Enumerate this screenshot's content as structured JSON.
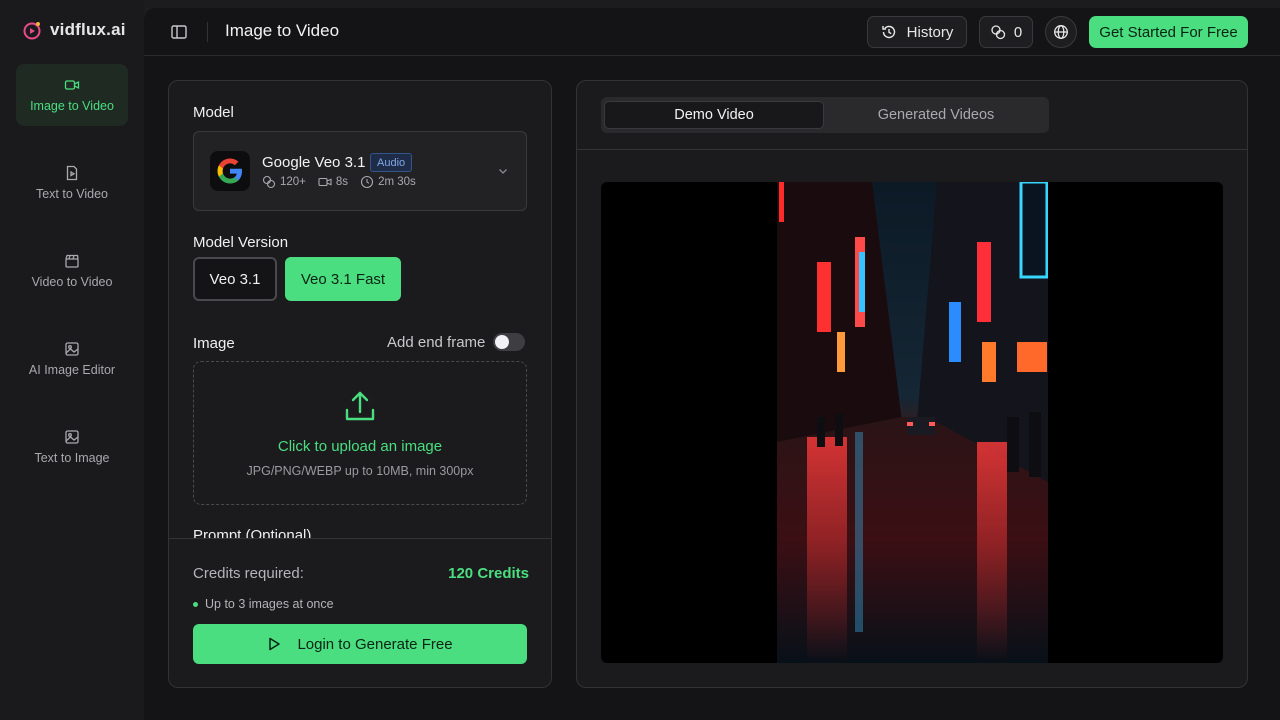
{
  "brand": {
    "name": "vidflux.ai"
  },
  "sidebar": {
    "items": [
      {
        "label": "Image to Video",
        "icon": "video-camera-icon",
        "active": true
      },
      {
        "label": "Text to Video",
        "icon": "document-icon",
        "active": false
      },
      {
        "label": "Video to Video",
        "icon": "clapperboard-icon",
        "active": false
      },
      {
        "label": "AI Image Editor",
        "icon": "image-icon",
        "active": false
      },
      {
        "label": "Text to Image",
        "icon": "image-icon",
        "active": false
      }
    ]
  },
  "header": {
    "title": "Image to Video",
    "history_label": "History",
    "credits_count": "0",
    "cta_label": "Get Started For Free"
  },
  "form": {
    "model_label": "Model",
    "model": {
      "name": "Google Veo 3.1",
      "badge": "Audio",
      "credits": "120+",
      "duration": "8s",
      "time": "2m 30s"
    },
    "version_label": "Model Version",
    "versions": [
      {
        "label": "Veo 3.1",
        "selected": false
      },
      {
        "label": "Veo 3.1 Fast",
        "selected": true
      }
    ],
    "image_label": "Image",
    "end_frame_label": "Add end frame",
    "upload_title": "Click to upload an image",
    "upload_hint": "JPG/PNG/WEBP up to 10MB, min 300px",
    "prompt_label": "Prompt (Optional)"
  },
  "footer": {
    "credits_label": "Credits required:",
    "credits_value": "120 Credits",
    "note": "Up to 3 images at once",
    "generate_label": "Login to Generate Free"
  },
  "preview": {
    "tabs": [
      {
        "label": "Demo Video",
        "active": true
      },
      {
        "label": "Generated Videos",
        "active": false
      }
    ]
  },
  "colors": {
    "accent": "#4ade80",
    "badge": "#7fa7e6"
  }
}
